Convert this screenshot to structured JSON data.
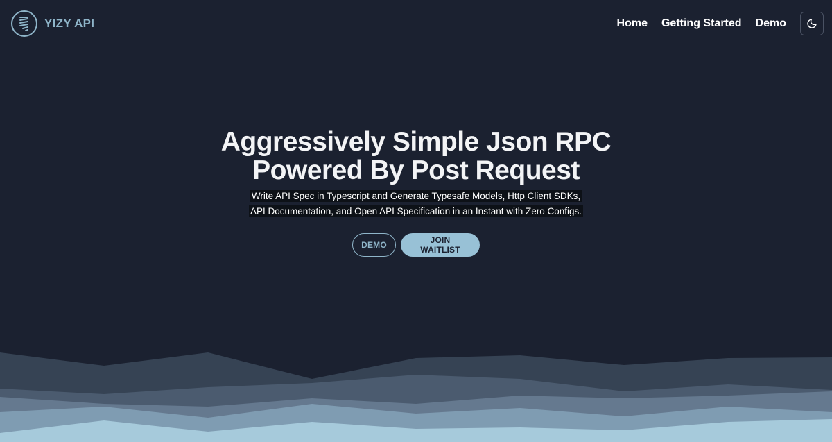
{
  "brand": {
    "name": "YIZY API",
    "icon": "spring-coil-icon"
  },
  "nav": {
    "links": [
      "Home",
      "Getting Started",
      "Demo"
    ],
    "theme_toggle_icon": "moon-icon"
  },
  "hero": {
    "title_line1": "Aggressively Simple Json RPC",
    "title_line2": "Powered By Post Request",
    "subtitle_line1": "Write API Spec in Typescript and Generate Typesafe Models, Http Client SDKs,",
    "subtitle_line2": "API Documentation, and Open API Specification in an Instant with Zero Configs.",
    "buttons": {
      "demo": "DEMO",
      "waitlist": "JOIN WAITLIST"
    }
  },
  "colors": {
    "background": "#1b2130",
    "accent": "#98c1d6",
    "wave_layers": [
      "#364354",
      "#4b5b6f",
      "#65798f",
      "#7f9cb2",
      "#a6cadb"
    ]
  }
}
